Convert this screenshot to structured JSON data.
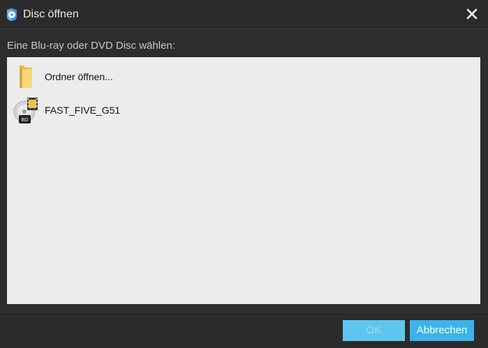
{
  "window": {
    "title": "Disc öffnen",
    "app_icon": "blu-ray-player-icon",
    "close_icon": "close-icon"
  },
  "prompt": "Eine Blu-ray oder DVD Disc wählen:",
  "list": {
    "items": [
      {
        "label": "Ordner öffnen...",
        "icon": "folder-icon"
      },
      {
        "label": "FAST_FIVE_G51",
        "icon": "bluray-disc-icon",
        "badge": "BD"
      }
    ]
  },
  "buttons": {
    "ok_label": "OK",
    "ok_enabled": false,
    "cancel_label": "Abbrechen"
  },
  "colors": {
    "accent": "#3bb3ea",
    "accent_disabled": "#5ec6ee",
    "background": "#2d2d2d",
    "list_background": "#ececec"
  }
}
